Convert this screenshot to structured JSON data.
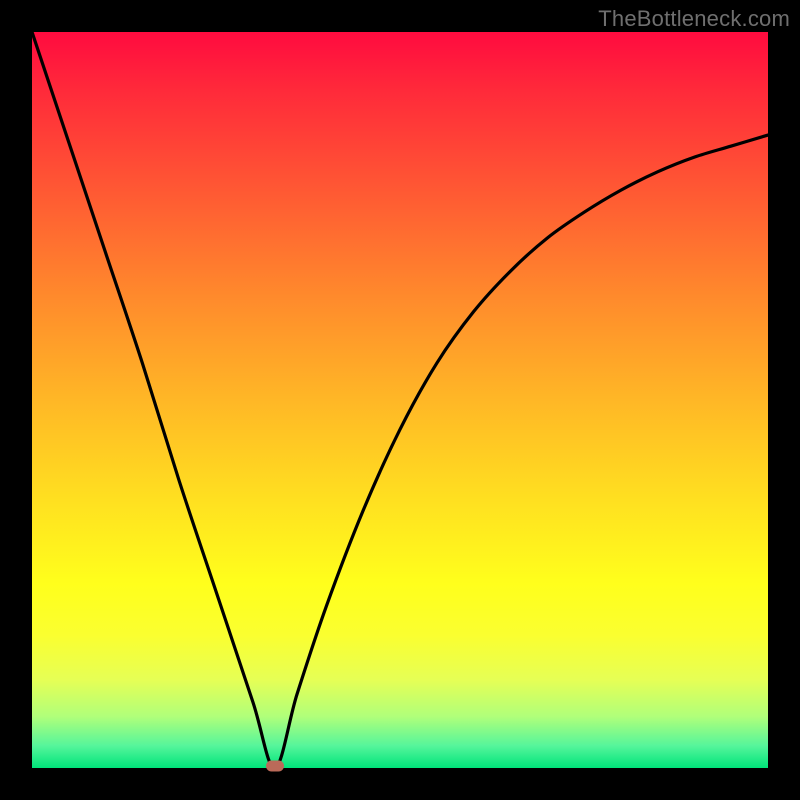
{
  "watermark": "TheBottleneck.com",
  "colors": {
    "frame": "#000000",
    "curve": "#000000",
    "marker": "#bb6a59",
    "gradient_top": "#ff0b3f",
    "gradient_bottom": "#00e47a"
  },
  "chart_data": {
    "type": "line",
    "title": "",
    "xlabel": "",
    "ylabel": "",
    "xlim": [
      0,
      100
    ],
    "ylim": [
      0,
      100
    ],
    "grid": false,
    "notes": "V-shaped curve. Left branch is near-linear from top-left to the minimum. Right branch rises with decreasing slope toward the right edge. Minimum marked by a small brown pill.",
    "minimum": {
      "x": 33,
      "y": 0
    },
    "series": [
      {
        "name": "left-branch",
        "x": [
          0,
          5,
          10,
          15,
          20,
          25,
          30,
          33
        ],
        "y": [
          100,
          85,
          70,
          55,
          39,
          24,
          9,
          0
        ]
      },
      {
        "name": "right-branch",
        "x": [
          33,
          36,
          40,
          45,
          50,
          55,
          60,
          65,
          70,
          75,
          80,
          85,
          90,
          95,
          100
        ],
        "y": [
          0,
          10,
          22,
          35,
          46,
          55,
          62,
          67.5,
          72,
          75.5,
          78.5,
          81,
          83,
          84.5,
          86
        ]
      }
    ]
  }
}
